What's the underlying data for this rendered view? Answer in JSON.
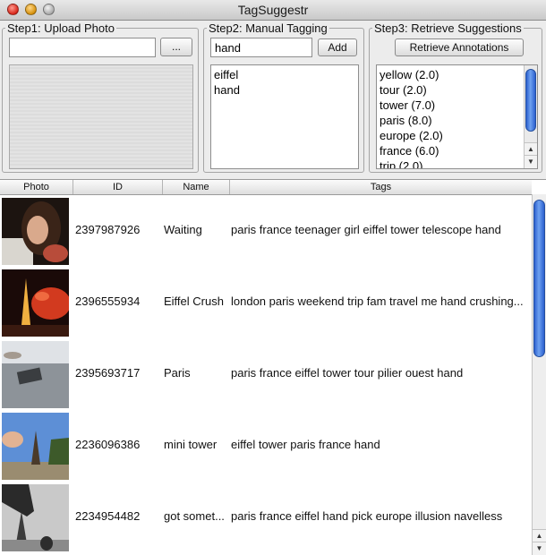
{
  "window": {
    "title": "TagSuggestr"
  },
  "step1": {
    "legend": "Step1: Upload Photo",
    "path_value": "",
    "browse_label": "..."
  },
  "step2": {
    "legend": "Step2: Manual Tagging",
    "tag_input_value": "hand",
    "add_label": "Add",
    "tags": [
      "eiffel",
      "hand"
    ]
  },
  "step3": {
    "legend": "Step3: Retrieve Suggestions",
    "retrieve_label": "Retrieve Annotations",
    "suggestions": [
      "yellow (2.0)",
      "tour (2.0)",
      "tower (7.0)",
      "paris (8.0)",
      "europe (2.0)",
      "france (6.0)",
      "trip (2.0)"
    ]
  },
  "table": {
    "columns": [
      "Photo",
      "ID",
      "Name",
      "Tags"
    ],
    "rows": [
      {
        "id": "2397987926",
        "name": "Waiting",
        "tags": "paris france teenager girl eiffel tower telescope hand",
        "thumb": "girl-with-telescope"
      },
      {
        "id": "2396555934",
        "name": "Eiffel Crush",
        "tags": "london paris weekend trip fam travel me hand crushing...",
        "thumb": "hand-crushing-tower-at-night"
      },
      {
        "id": "2395693717",
        "name": "Paris",
        "tags": "paris france eiffel tower tour pilier ouest hand",
        "thumb": "tower-pillar-sign"
      },
      {
        "id": "2236096386",
        "name": "mini tower",
        "tags": "eiffel tower paris france hand",
        "thumb": "fingers-pinching-mini-tower"
      },
      {
        "id": "2234954482",
        "name": "got somet...",
        "tags": "paris france eiffel hand pick europe illusion navelless",
        "thumb": "hand-picking-tower-bw"
      }
    ]
  },
  "colors": {
    "scroll_thumb": "#3a6ee0",
    "close": "#e0443a",
    "minimize": "#e5a21d"
  }
}
